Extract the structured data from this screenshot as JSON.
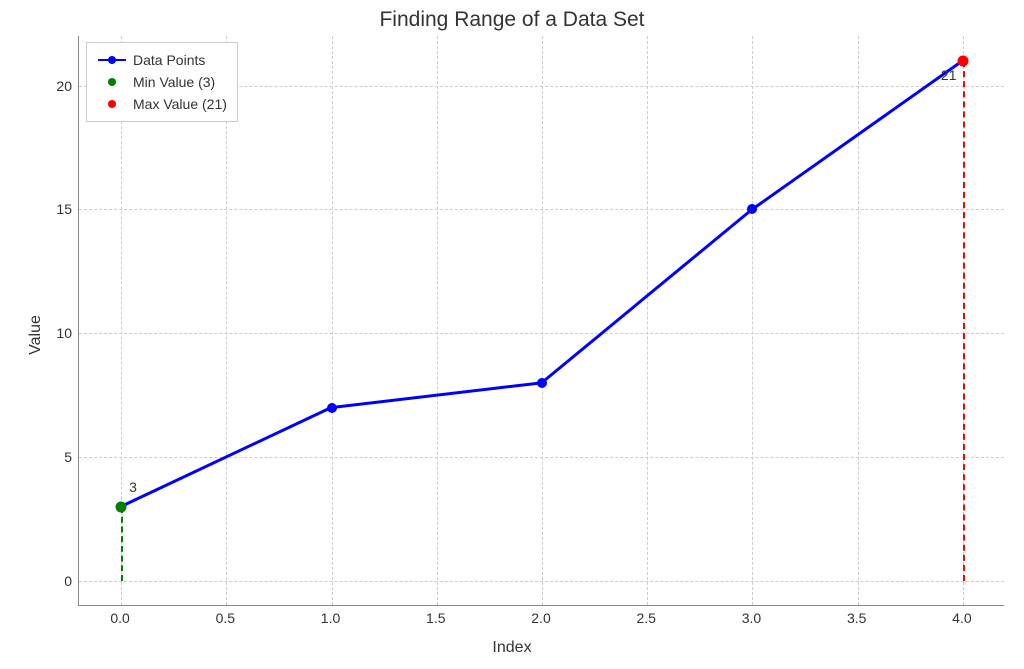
{
  "chart_data": {
    "type": "line",
    "title": "Finding Range of a Data Set",
    "xlabel": "Index",
    "ylabel": "Value",
    "x": [
      0,
      1,
      2,
      3,
      4
    ],
    "y": [
      3,
      7,
      8,
      15,
      21
    ],
    "xlim": [
      -0.2,
      4.2
    ],
    "ylim": [
      -1,
      22
    ],
    "x_ticks": [
      0.0,
      0.5,
      1.0,
      1.5,
      2.0,
      2.5,
      3.0,
      3.5,
      4.0
    ],
    "x_tick_labels": [
      "0.0",
      "0.5",
      "1.0",
      "1.5",
      "2.0",
      "2.5",
      "3.0",
      "3.5",
      "4.0"
    ],
    "y_ticks": [
      0,
      5,
      10,
      15,
      20
    ],
    "y_tick_labels": [
      "0",
      "5",
      "10",
      "15",
      "20"
    ],
    "min_marker": {
      "x": 0,
      "y": 3,
      "label": "3",
      "color": "green"
    },
    "max_marker": {
      "x": 4,
      "y": 21,
      "label": "21",
      "color": "red"
    },
    "legend": [
      {
        "label": "Data Points",
        "type": "line-marker",
        "color": "blue"
      },
      {
        "label": "Min Value (3)",
        "type": "marker",
        "color": "green"
      },
      {
        "label": "Max Value (21)",
        "type": "marker",
        "color": "red"
      }
    ]
  }
}
